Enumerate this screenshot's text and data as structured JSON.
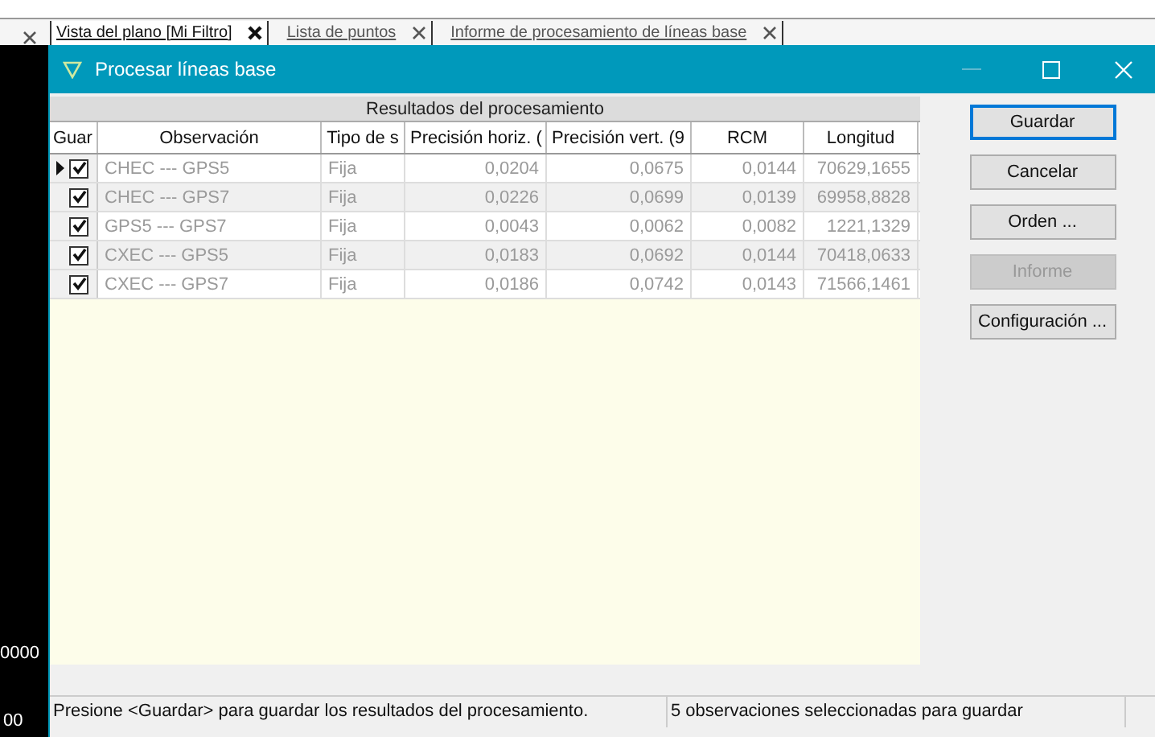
{
  "tabs": [
    {
      "label": "Vista del plano [Mi Filtro]",
      "selected": true
    },
    {
      "label": "Lista de puntos",
      "selected": false
    },
    {
      "label": "Informe de procesamiento de líneas base",
      "selected": false
    }
  ],
  "background": {
    "axis_labels": [
      "0000",
      "00"
    ]
  },
  "dialog": {
    "title": "Procesar líneas base",
    "table": {
      "group_header": "Resultados del procesamiento",
      "columns": [
        "Guar",
        "Observación",
        "Tipo de s",
        "Precisión horiz. (",
        "Precisión vert. (9",
        "RCM",
        "Longitud"
      ],
      "rows": [
        {
          "current": true,
          "checked": true,
          "observation": "CHEC --- GPS5",
          "type": "Fija",
          "horiz": "0,0204",
          "vert": "0,0675",
          "rcm": "0,0144",
          "length": "70629,1655"
        },
        {
          "current": false,
          "checked": true,
          "observation": "CHEC --- GPS7",
          "type": "Fija",
          "horiz": "0,0226",
          "vert": "0,0699",
          "rcm": "0,0139",
          "length": "69958,8828"
        },
        {
          "current": false,
          "checked": true,
          "observation": "GPS5 --- GPS7",
          "type": "Fija",
          "horiz": "0,0043",
          "vert": "0,0062",
          "rcm": "0,0082",
          "length": "1221,1329"
        },
        {
          "current": false,
          "checked": true,
          "observation": "CXEC --- GPS5",
          "type": "Fija",
          "horiz": "0,0183",
          "vert": "0,0692",
          "rcm": "0,0144",
          "length": "70418,0633"
        },
        {
          "current": false,
          "checked": true,
          "observation": "CXEC --- GPS7",
          "type": "Fija",
          "horiz": "0,0186",
          "vert": "0,0742",
          "rcm": "0,0143",
          "length": "71566,1461"
        }
      ]
    },
    "buttons": [
      {
        "label": "Guardar",
        "default": true,
        "disabled": false
      },
      {
        "label": "Cancelar",
        "default": false,
        "disabled": false
      },
      {
        "label": "Orden ...",
        "default": false,
        "disabled": false
      },
      {
        "label": "Informe",
        "default": false,
        "disabled": true
      },
      {
        "label": "Configuración ...",
        "default": false,
        "disabled": false
      }
    ],
    "status_bar": [
      "Presione <Guardar> para guardar los resultados del procesamiento.",
      "5 observaciones seleccionadas para guardar"
    ]
  }
}
